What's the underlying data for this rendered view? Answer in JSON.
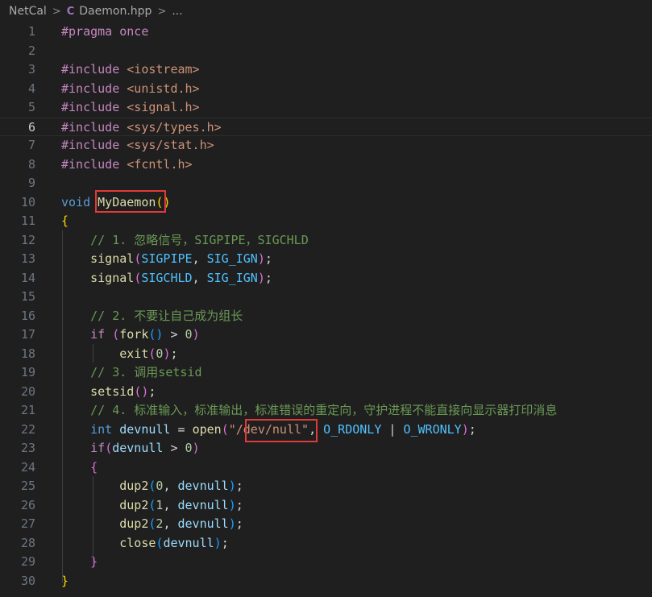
{
  "breadcrumb": {
    "folder": "NetCal",
    "file": "Daemon.hpp",
    "more": "..."
  },
  "editor": {
    "current_line": 6,
    "lines": [
      [
        {
          "t": "#pragma",
          "c": "c-dir"
        },
        {
          "t": " "
        },
        {
          "t": "once",
          "c": "c-dir"
        }
      ],
      [],
      [
        {
          "t": "#include",
          "c": "c-dir"
        },
        {
          "t": " "
        },
        {
          "t": "<iostream>",
          "c": "c-str"
        }
      ],
      [
        {
          "t": "#include",
          "c": "c-dir"
        },
        {
          "t": " "
        },
        {
          "t": "<unistd.h>",
          "c": "c-str"
        }
      ],
      [
        {
          "t": "#include",
          "c": "c-dir"
        },
        {
          "t": " "
        },
        {
          "t": "<signal.h>",
          "c": "c-str"
        }
      ],
      [
        {
          "t": "#include",
          "c": "c-dir"
        },
        {
          "t": " "
        },
        {
          "t": "<sys/types.h>",
          "c": "c-str"
        }
      ],
      [
        {
          "t": "#include",
          "c": "c-dir"
        },
        {
          "t": " "
        },
        {
          "t": "<sys/stat.h>",
          "c": "c-str"
        }
      ],
      [
        {
          "t": "#include",
          "c": "c-dir"
        },
        {
          "t": " "
        },
        {
          "t": "<fcntl.h>",
          "c": "c-str"
        }
      ],
      [],
      [
        {
          "t": "void",
          "c": "c-type"
        },
        {
          "t": " "
        },
        {
          "t": "MyDaemon",
          "c": "c-fn"
        },
        {
          "t": "(",
          "c": "c-p1"
        },
        {
          "t": ")",
          "c": "c-p1"
        }
      ],
      [
        {
          "t": "{",
          "c": "c-p1"
        }
      ],
      [
        {
          "t": "    "
        },
        {
          "t": "// 1. 忽略信号，SIGPIPE，SIGCHLD",
          "c": "c-com"
        }
      ],
      [
        {
          "t": "    "
        },
        {
          "t": "signal",
          "c": "c-fn"
        },
        {
          "t": "(",
          "c": "c-p2"
        },
        {
          "t": "SIGPIPE",
          "c": "c-const"
        },
        {
          "t": ", ",
          "c": "c-op"
        },
        {
          "t": "SIG_IGN",
          "c": "c-const"
        },
        {
          "t": ")",
          "c": "c-p2"
        },
        {
          "t": ";",
          "c": "c-op"
        }
      ],
      [
        {
          "t": "    "
        },
        {
          "t": "signal",
          "c": "c-fn"
        },
        {
          "t": "(",
          "c": "c-p2"
        },
        {
          "t": "SIGCHLD",
          "c": "c-const"
        },
        {
          "t": ", ",
          "c": "c-op"
        },
        {
          "t": "SIG_IGN",
          "c": "c-const"
        },
        {
          "t": ")",
          "c": "c-p2"
        },
        {
          "t": ";",
          "c": "c-op"
        }
      ],
      [],
      [
        {
          "t": "    "
        },
        {
          "t": "// 2. 不要让自己成为组长",
          "c": "c-com"
        }
      ],
      [
        {
          "t": "    "
        },
        {
          "t": "if",
          "c": "c-dir"
        },
        {
          "t": " "
        },
        {
          "t": "(",
          "c": "c-p2"
        },
        {
          "t": "fork",
          "c": "c-fn"
        },
        {
          "t": "(",
          "c": "c-p3"
        },
        {
          "t": ")",
          "c": "c-p3"
        },
        {
          "t": " > ",
          "c": "c-op"
        },
        {
          "t": "0",
          "c": "c-num"
        },
        {
          "t": ")",
          "c": "c-p2"
        }
      ],
      [
        {
          "t": "        "
        },
        {
          "t": "exit",
          "c": "c-fn"
        },
        {
          "t": "(",
          "c": "c-p2"
        },
        {
          "t": "0",
          "c": "c-num"
        },
        {
          "t": ")",
          "c": "c-p2"
        },
        {
          "t": ";",
          "c": "c-op"
        }
      ],
      [
        {
          "t": "    "
        },
        {
          "t": "// 3. 调用setsid",
          "c": "c-com"
        }
      ],
      [
        {
          "t": "    "
        },
        {
          "t": "setsid",
          "c": "c-fn"
        },
        {
          "t": "(",
          "c": "c-p2"
        },
        {
          "t": ")",
          "c": "c-p2"
        },
        {
          "t": ";",
          "c": "c-op"
        }
      ],
      [
        {
          "t": "    "
        },
        {
          "t": "// 4. 标准输入，标准输出，标准错误的重定向，守护进程不能直接向显示器打印消息",
          "c": "c-com"
        }
      ],
      [
        {
          "t": "    "
        },
        {
          "t": "int",
          "c": "c-type"
        },
        {
          "t": " "
        },
        {
          "t": "devnull",
          "c": "c-var"
        },
        {
          "t": " = ",
          "c": "c-op"
        },
        {
          "t": "open",
          "c": "c-fn"
        },
        {
          "t": "(",
          "c": "c-p2"
        },
        {
          "t": "\"/dev/null\"",
          "c": "c-str"
        },
        {
          "t": ", ",
          "c": "c-op"
        },
        {
          "t": "O_RDONLY",
          "c": "c-const"
        },
        {
          "t": " | ",
          "c": "c-op"
        },
        {
          "t": "O_WRONLY",
          "c": "c-const"
        },
        {
          "t": ")",
          "c": "c-p2"
        },
        {
          "t": ";",
          "c": "c-op"
        }
      ],
      [
        {
          "t": "    "
        },
        {
          "t": "if",
          "c": "c-dir"
        },
        {
          "t": "(",
          "c": "c-p2"
        },
        {
          "t": "devnull",
          "c": "c-var"
        },
        {
          "t": " > ",
          "c": "c-op"
        },
        {
          "t": "0",
          "c": "c-num"
        },
        {
          "t": ")",
          "c": "c-p2"
        }
      ],
      [
        {
          "t": "    "
        },
        {
          "t": "{",
          "c": "c-p2"
        }
      ],
      [
        {
          "t": "        "
        },
        {
          "t": "dup2",
          "c": "c-fn"
        },
        {
          "t": "(",
          "c": "c-p3"
        },
        {
          "t": "0",
          "c": "c-num"
        },
        {
          "t": ", ",
          "c": "c-op"
        },
        {
          "t": "devnull",
          "c": "c-var"
        },
        {
          "t": ")",
          "c": "c-p3"
        },
        {
          "t": ";",
          "c": "c-op"
        }
      ],
      [
        {
          "t": "        "
        },
        {
          "t": "dup2",
          "c": "c-fn"
        },
        {
          "t": "(",
          "c": "c-p3"
        },
        {
          "t": "1",
          "c": "c-num"
        },
        {
          "t": ", ",
          "c": "c-op"
        },
        {
          "t": "devnull",
          "c": "c-var"
        },
        {
          "t": ")",
          "c": "c-p3"
        },
        {
          "t": ";",
          "c": "c-op"
        }
      ],
      [
        {
          "t": "        "
        },
        {
          "t": "dup2",
          "c": "c-fn"
        },
        {
          "t": "(",
          "c": "c-p3"
        },
        {
          "t": "2",
          "c": "c-num"
        },
        {
          "t": ", ",
          "c": "c-op"
        },
        {
          "t": "devnull",
          "c": "c-var"
        },
        {
          "t": ")",
          "c": "c-p3"
        },
        {
          "t": ";",
          "c": "c-op"
        }
      ],
      [
        {
          "t": "        "
        },
        {
          "t": "close",
          "c": "c-fn"
        },
        {
          "t": "(",
          "c": "c-p3"
        },
        {
          "t": "devnull",
          "c": "c-var"
        },
        {
          "t": ")",
          "c": "c-p3"
        },
        {
          "t": ";",
          "c": "c-op"
        }
      ],
      [
        {
          "t": "    "
        },
        {
          "t": "}",
          "c": "c-p2"
        }
      ],
      [
        {
          "t": "}",
          "c": "c-p1"
        }
      ]
    ]
  },
  "colors": {
    "annotation_box": "#e03a3a",
    "background": "#1f1f1f"
  }
}
